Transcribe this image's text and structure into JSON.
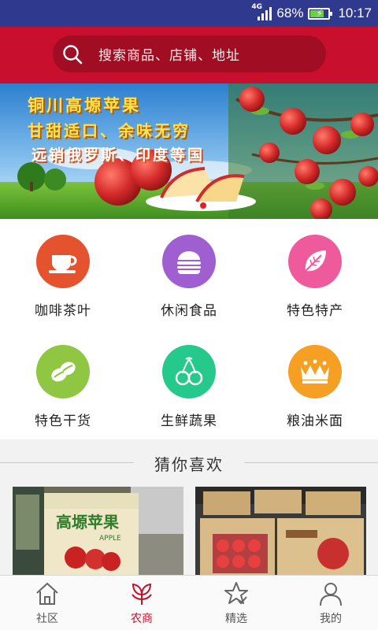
{
  "status_bar": {
    "network": "4G",
    "battery": "68%",
    "time": "10:17"
  },
  "search": {
    "placeholder": "搜索商品、店铺、地址"
  },
  "banner": {
    "line1": "铜川高塬苹果",
    "line2": "甘甜适口、余味无穷",
    "line3": "远销俄罗斯、印度等国"
  },
  "categories": [
    {
      "label": "咖啡茶叶",
      "icon": "coffee-cup-icon",
      "color": "#e4532e"
    },
    {
      "label": "休闲食品",
      "icon": "burger-icon",
      "color": "#a05fd0"
    },
    {
      "label": "特色特产",
      "icon": "leaf-icon",
      "color": "#ef5a9c"
    },
    {
      "label": "特色干货",
      "icon": "beans-icon",
      "color": "#8fc742"
    },
    {
      "label": "生鲜蔬果",
      "icon": "cherries-icon",
      "color": "#26c98c"
    },
    {
      "label": "粮油米面",
      "icon": "wheat-icon",
      "color": "#f6a023"
    }
  ],
  "section": {
    "title": "猜你喜欢"
  },
  "products": [
    {
      "image": "apple-box-photo",
      "box_text": "高塬苹果",
      "box_sub": "APPLE"
    },
    {
      "image": "apple-crates-photo"
    }
  ],
  "tabs": [
    {
      "label": "社区",
      "icon": "home-icon",
      "active": false
    },
    {
      "label": "农商",
      "icon": "plant-icon",
      "active": true
    },
    {
      "label": "精选",
      "icon": "star-icon",
      "active": false
    },
    {
      "label": "我的",
      "icon": "person-icon",
      "active": false
    }
  ],
  "colors": {
    "status_bar": "#2f3a8f",
    "header": "#c8102e",
    "active_tab": "#c8102e"
  }
}
